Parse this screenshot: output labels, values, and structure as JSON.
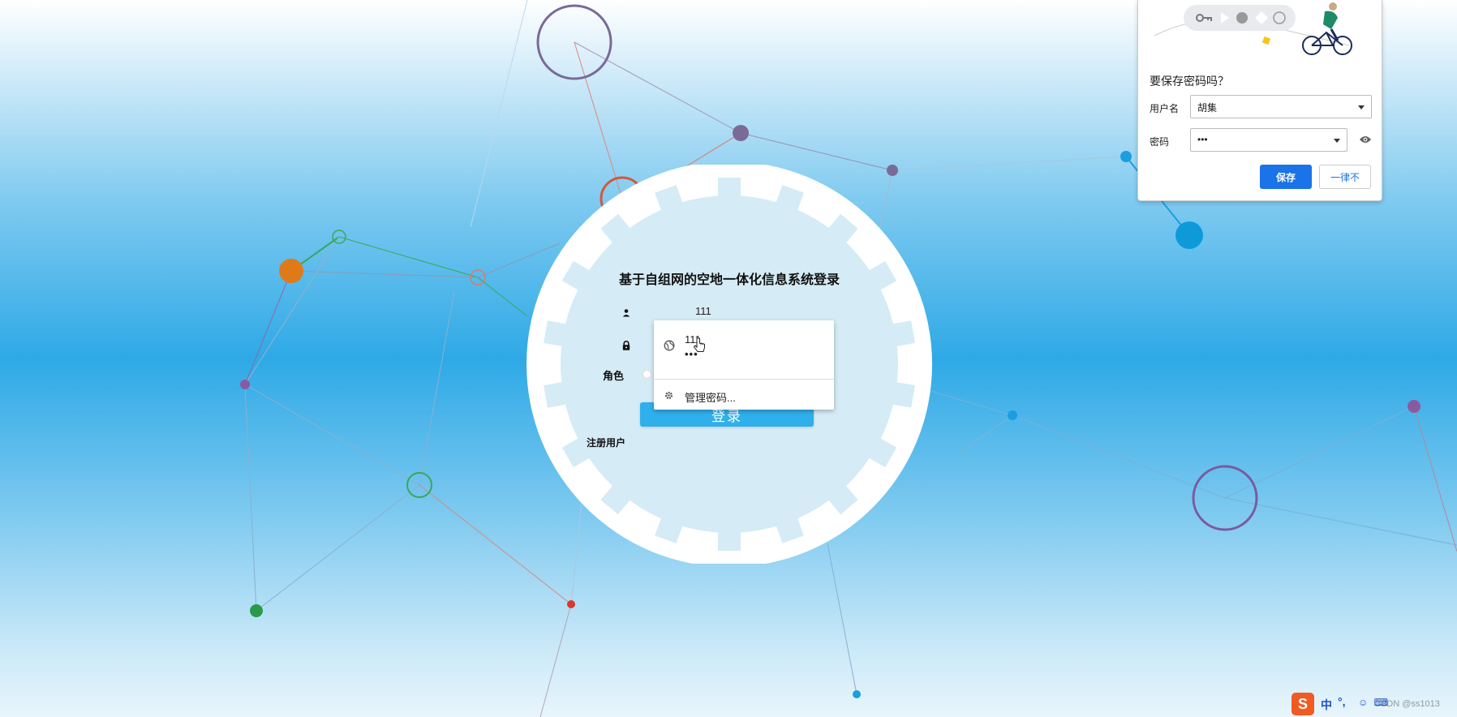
{
  "login": {
    "title": "基于自组网的空地一体化信息系统登录",
    "username_value": "111",
    "role_label": "角色",
    "login_button": "登录",
    "register_link": "注册用户"
  },
  "autofill": {
    "suggestion_username": "111",
    "suggestion_password": "•••",
    "manage_label": "管理密码..."
  },
  "save_password": {
    "title": "要保存密码吗？",
    "username_label": "用户名",
    "username_value": "胡集",
    "password_label": "密码",
    "password_value": "•••",
    "save_button": "保存",
    "never_button": "一律不"
  },
  "tray": {
    "ime_logo": "S",
    "ime_lang": "中",
    "ime_punct": "°,",
    "ime_tools": "☺ ⌨",
    "watermark": "CSDN @ss1013"
  },
  "colors": {
    "accent_blue": "#2fb0ec",
    "chrome_blue": "#1a73e8",
    "input_underline": "#f5d24a",
    "ime_orange": "#f15a22"
  },
  "icons": [
    "user-icon",
    "lock-icon",
    "globe-icon",
    "gear-icon",
    "eye-icon",
    "cursor-icon",
    "key-icon"
  ]
}
